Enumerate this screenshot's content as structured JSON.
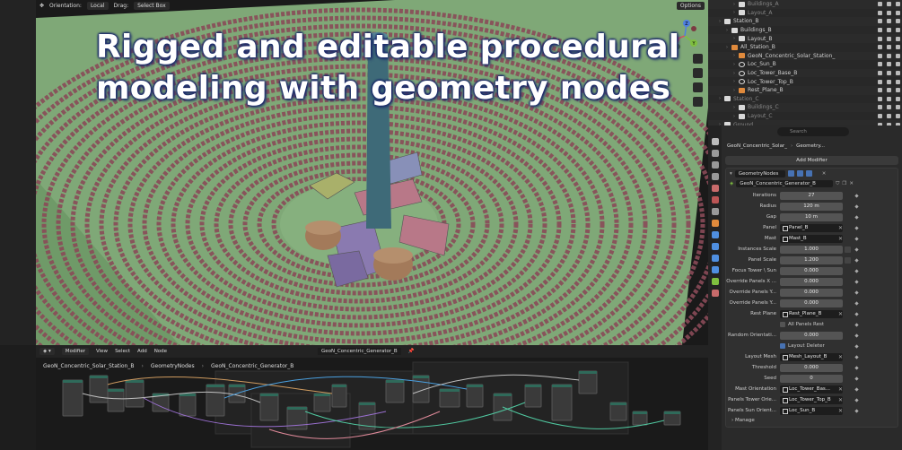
{
  "viewport": {
    "orientation_label": "Orientation:",
    "orientation_value": "Local",
    "drag_label": "Drag:",
    "drag_value": "Select Box",
    "options_label": "Options",
    "overlay_title_line1": "Rigged and editable procedural",
    "overlay_title_line2": "modeling with geometry nodes",
    "gizmo_axes": [
      "X",
      "Y",
      "Z"
    ],
    "colors": {
      "ground": "#7fa877",
      "mirror": "#8a4a58",
      "tower": "#3e6a78",
      "tank": "#a37a5a"
    }
  },
  "outliner": {
    "rows": [
      {
        "label": "Buildings_A",
        "indent": 3,
        "icon": "col",
        "dim": true
      },
      {
        "label": "Layout_A",
        "indent": 3,
        "icon": "col",
        "dim": true
      },
      {
        "label": "Station_B",
        "indent": 1,
        "icon": "col",
        "dim": false
      },
      {
        "label": "Buildings_B",
        "indent": 2,
        "icon": "col",
        "dim": false
      },
      {
        "label": "Layout_B",
        "indent": 3,
        "icon": "col",
        "dim": false
      },
      {
        "label": "All_Station_B",
        "indent": 2,
        "icon": "obj",
        "dim": false
      },
      {
        "label": "GeoN_Concentric_Solar_Station_",
        "indent": 3,
        "icon": "obj",
        "dim": false
      },
      {
        "label": "Loc_Sun_B",
        "indent": 3,
        "icon": "emp",
        "dim": false
      },
      {
        "label": "Loc_Tower_Base_B",
        "indent": 3,
        "icon": "emp",
        "dim": false
      },
      {
        "label": "Loc_Tower_Top_B",
        "indent": 3,
        "icon": "emp",
        "dim": false
      },
      {
        "label": "Rest_Plane_B",
        "indent": 3,
        "icon": "obj",
        "dim": false
      },
      {
        "label": "Station_C",
        "indent": 1,
        "icon": "col",
        "dim": true
      },
      {
        "label": "Buildings_C",
        "indent": 3,
        "icon": "col",
        "dim": true
      },
      {
        "label": "Layout_C",
        "indent": 3,
        "icon": "col",
        "dim": true
      },
      {
        "label": "Ground",
        "indent": 1,
        "icon": "col",
        "dim": true
      }
    ]
  },
  "properties": {
    "search_placeholder": "Search",
    "breadcrumb_object": "GeoN_Concentric_Solar_",
    "breadcrumb_modifier": "Geometry...",
    "add_modifier": "Add Modifier",
    "modifier_name": "GeometryNodes",
    "node_group": "GeoN_Concentric_Generator_B",
    "params": [
      {
        "label": "Iterations",
        "value": "27",
        "kind": "num"
      },
      {
        "label": "Radius",
        "value": "120 m",
        "kind": "num"
      },
      {
        "label": "Gap",
        "value": "10 m",
        "kind": "num"
      },
      {
        "label": "Panel",
        "value": "Panel_B",
        "kind": "obj"
      },
      {
        "label": "Mast",
        "value": "Mast_B",
        "kind": "obj"
      },
      {
        "label": "Instances Scale",
        "value": "1.000",
        "kind": "num"
      },
      {
        "label": "Panel Scale",
        "value": "1.200",
        "kind": "num"
      },
      {
        "label": "Focus Tower \\ Sun",
        "value": "0.000",
        "kind": "num"
      },
      {
        "label": "Override Panels X ...",
        "value": "0.000",
        "kind": "num"
      },
      {
        "label": "Override Panels Y...",
        "value": "0.000",
        "kind": "num"
      },
      {
        "label": "Override Panels Y...",
        "value": "0.000",
        "kind": "num"
      },
      {
        "label": "Rest Plane",
        "value": "Rest_Plane_B",
        "kind": "obj"
      },
      {
        "label": "",
        "value": "All Panels Rest",
        "kind": "check",
        "checked": false
      },
      {
        "label": "Random Orientati...",
        "value": "0.000",
        "kind": "num"
      },
      {
        "label": "",
        "value": "Layout Deleter",
        "kind": "check",
        "checked": true
      },
      {
        "label": "Layout Mesh",
        "value": "Mesh_Layout_B",
        "kind": "obj"
      },
      {
        "label": "Threshold",
        "value": "0.000",
        "kind": "num"
      },
      {
        "label": "Seed",
        "value": "0",
        "kind": "num"
      },
      {
        "label": "Mast Orientation",
        "value": "Loc_Tower_Bas...",
        "kind": "obj"
      },
      {
        "label": "Panels Tower Orie...",
        "value": "Loc_Tower_Top_B",
        "kind": "obj"
      },
      {
        "label": "Panels Sun Orient...",
        "value": "Loc_Sun_B",
        "kind": "obj"
      }
    ],
    "manage_label": "Manage"
  },
  "node_editor": {
    "editor_type": "Modifier",
    "menus": [
      "View",
      "Select",
      "Add",
      "Node"
    ],
    "group_name": "GeoN_Concentric_Generator_B",
    "breadcrumb": [
      "GeoN_Concentric_Solar_Station_B",
      "GeometryNodes",
      "GeoN_Concentric_Generator_B"
    ]
  }
}
